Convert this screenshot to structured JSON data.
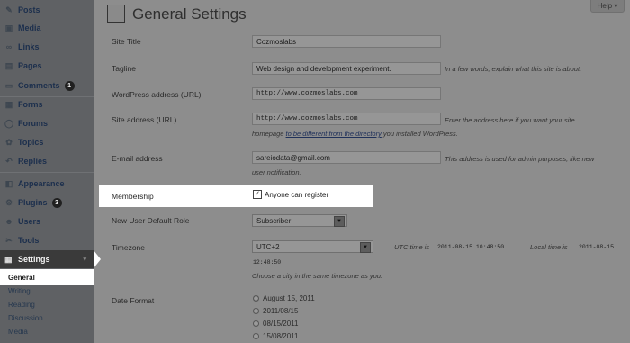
{
  "sidebar": {
    "items": [
      {
        "label": "Posts",
        "icon": "pin-icon"
      },
      {
        "label": "Media",
        "icon": "media-icon"
      },
      {
        "label": "Links",
        "icon": "link-icon"
      },
      {
        "label": "Pages",
        "icon": "page-icon"
      },
      {
        "label": "Comments",
        "icon": "comment-icon",
        "badge": "1"
      },
      {
        "label": "Forms",
        "icon": "form-icon"
      },
      {
        "label": "Forums",
        "icon": "forum-icon"
      },
      {
        "label": "Topics",
        "icon": "topic-icon"
      },
      {
        "label": "Replies",
        "icon": "reply-icon"
      },
      {
        "label": "Appearance",
        "icon": "appearance-icon"
      },
      {
        "label": "Plugins",
        "icon": "plugin-icon",
        "badge": "3"
      },
      {
        "label": "Users",
        "icon": "users-icon"
      },
      {
        "label": "Tools",
        "icon": "tools-icon"
      }
    ],
    "settings_label": "Settings",
    "submenu": [
      "General",
      "Writing",
      "Reading",
      "Discussion",
      "Media"
    ]
  },
  "header": {
    "title": "General Settings",
    "help": "Help ▾"
  },
  "form": {
    "site_title": {
      "label": "Site Title",
      "value": "Cozmoslabs"
    },
    "tagline": {
      "label": "Tagline",
      "value": "Web design and development experiment.",
      "desc": "In a few words, explain what this site is about."
    },
    "wp_address": {
      "label": "WordPress address (URL)",
      "value": "http://www.cozmoslabs.com"
    },
    "site_address": {
      "label": "Site address (URL)",
      "value": "http://www.cozmoslabs.com",
      "desc1": "Enter the address here if you want your site",
      "desc2_pre": "homepage ",
      "desc2_link": "to be different from the directory",
      "desc2_post": " you installed WordPress."
    },
    "email": {
      "label": "E-mail address",
      "value": "sareiodata@gmail.com",
      "desc1": "This address is used for admin purposes, like new",
      "desc2": "user notification."
    },
    "membership": {
      "label": "Membership",
      "checkbox": "Anyone can register",
      "checked": true
    },
    "default_role": {
      "label": "New User Default Role",
      "value": "Subscriber"
    },
    "timezone": {
      "label": "Timezone",
      "value": "UTC+2",
      "utc_label": "UTC time is",
      "utc_time": "2011-08-15 10:48:50",
      "local_label": "Local time is",
      "local_time_a": "2011-08-15",
      "local_time_b": "12:48:50",
      "desc": "Choose a city in the same timezone as you."
    },
    "date_format": {
      "label": "Date Format",
      "options": [
        "August 15, 2011",
        "2011/08/15",
        "08/15/2011",
        "15/08/2011"
      ],
      "selected": 0
    }
  }
}
